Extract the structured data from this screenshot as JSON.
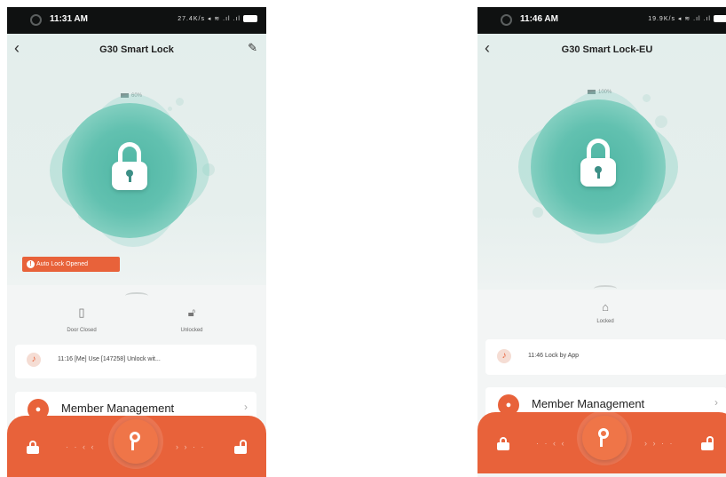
{
  "left": {
    "status": {
      "time": "11:31 AM",
      "icons": "27.4K/s ◂ ≋ .ıl .ıl"
    },
    "title": "G30 Smart Lock",
    "battery": "60%",
    "alert": "Auto Lock Opened",
    "door_status": "Door Closed",
    "lock_status": "Unlocked",
    "last_log": "11:16  [Me]  Use  [147258]  Unlock wit...",
    "member_label": "Member Management"
  },
  "right": {
    "status": {
      "time": "11:46 AM",
      "icons": "19.9K/s ◂ ≋ .ıl .ıl"
    },
    "title": "G30 Smart Lock-EU",
    "battery": "100%",
    "lock_status": "Locked",
    "last_log": "11:46  Lock by App",
    "member_label": "Member Management"
  },
  "icons": {
    "back": "chevron-left-icon",
    "edit": "pencil-icon",
    "lock": "padlock-icon",
    "door": "door-icon",
    "bell": "bell-icon",
    "member": "person-icon",
    "key": "key-icon"
  },
  "colors": {
    "accent": "#e8623a",
    "teal": "#62c1b0",
    "hero_bg": "#e3eeec"
  }
}
